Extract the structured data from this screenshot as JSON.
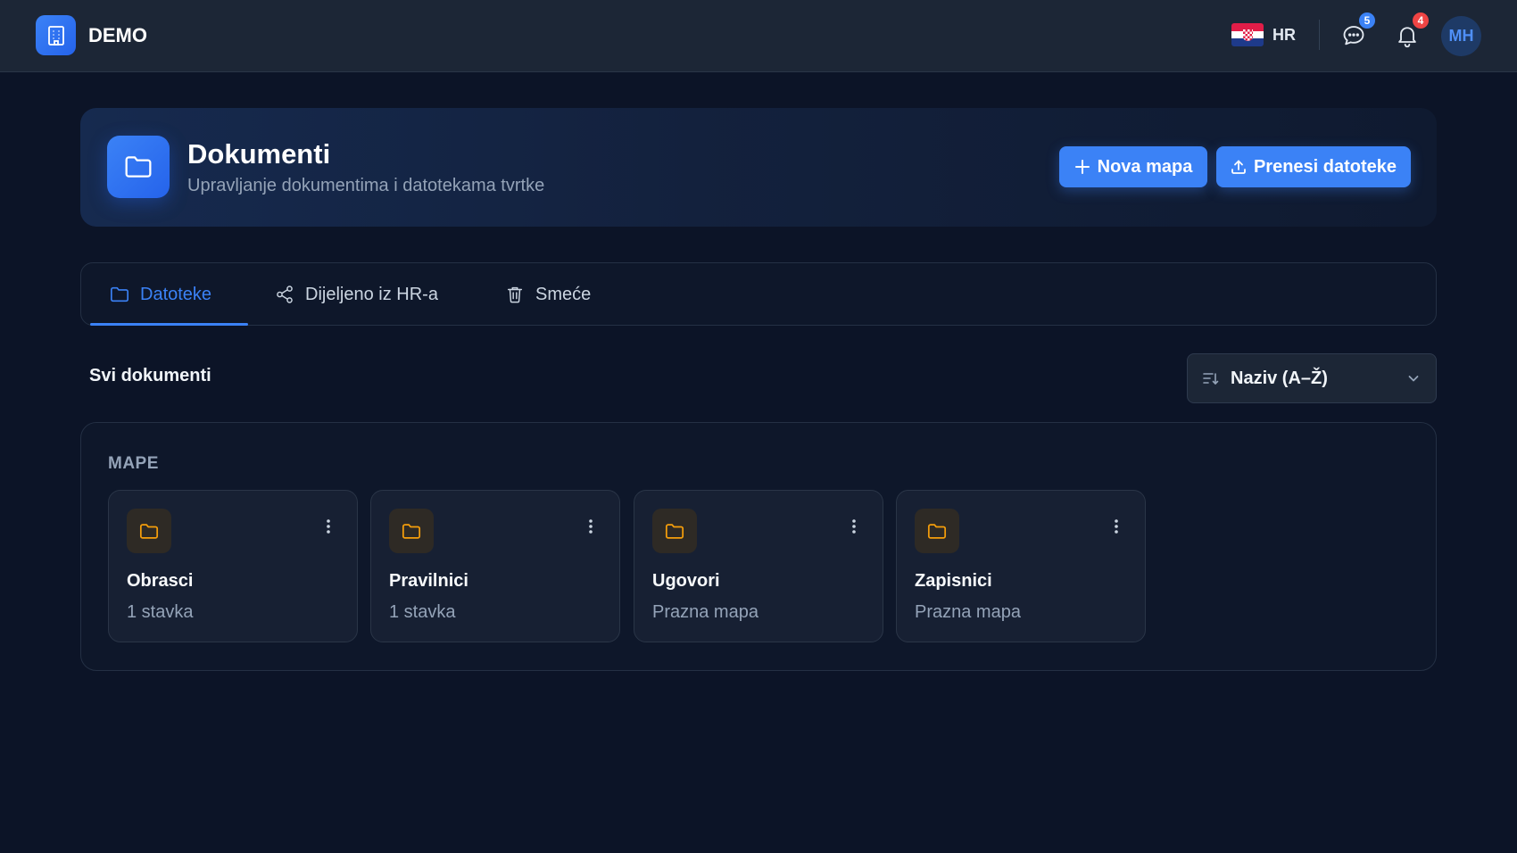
{
  "topbar": {
    "brand_name": "DEMO",
    "language": "HR",
    "messages_count": "5",
    "notifications_count": "4",
    "avatar_initials": "MH"
  },
  "header": {
    "title": "Dokumenti",
    "subtitle": "Upravljanje dokumentima i datotekama tvrtke",
    "new_folder_label": "Nova mapa",
    "upload_label": "Prenesi datoteke"
  },
  "tabs": [
    {
      "label": "Datoteke",
      "icon": "folder-icon",
      "active": true
    },
    {
      "label": "Dijeljeno iz HR-a",
      "icon": "share-icon",
      "active": false
    },
    {
      "label": "Smeće",
      "icon": "trash-icon",
      "active": false
    }
  ],
  "section": {
    "title": "Svi dokumenti",
    "sort_selected": "Naziv (A–Ž)"
  },
  "folders": {
    "label": "MAPE",
    "items": [
      {
        "name": "Obrasci",
        "meta": "1 stavka"
      },
      {
        "name": "Pravilnici",
        "meta": "1 stavka"
      },
      {
        "name": "Ugovori",
        "meta": "Prazna mapa"
      },
      {
        "name": "Zapisnici",
        "meta": "Prazna mapa"
      }
    ]
  },
  "colors": {
    "background": "#0c1427",
    "topbar": "#1c2636",
    "accent": "#3b82f6",
    "folder_icon": "#f59e0b",
    "badge_messages": "#3b82f6",
    "badge_notifications": "#ef4444"
  }
}
